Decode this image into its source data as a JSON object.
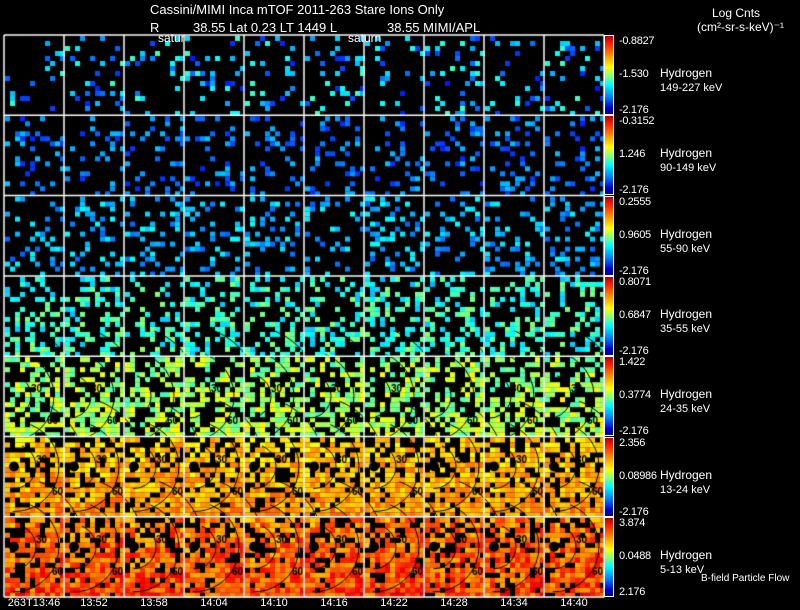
{
  "header": {
    "line1": "Cassini/MIMI Inca mTOF  2011-263    Stare    Ions Only",
    "line2_r": "R",
    "line2_rest": "38.55 Lat 0.23 LT 1449 L",
    "line2_l": "38.55  MIMI/APL",
    "overlay_left": "satur",
    "overlay_mid": "saturn"
  },
  "units": {
    "line1": "Log Cnts",
    "line2": "(cm²-sr-s-keV)⁻¹"
  },
  "footer_note": "B-field Particle Flow",
  "colormap": "jet",
  "chart_data": {
    "type": "heatmap",
    "columns": [
      "263T13:46",
      "13:52",
      "13:58",
      "14:04",
      "14:10",
      "14:16",
      "14:22",
      "14:28",
      "14:34",
      "14:40"
    ],
    "rows": [
      {
        "species": "Hydrogen",
        "energy": "149-227 keV",
        "cb_max": "-0.8827",
        "cb_mid": "-1.530",
        "cb_min": "-2.176"
      },
      {
        "species": "Hydrogen",
        "energy": "90-149 keV",
        "cb_max": "-0.3152",
        "cb_mid": "1.246",
        "cb_min": "-2.176"
      },
      {
        "species": "Hydrogen",
        "energy": "55-90 keV",
        "cb_max": "0.2555",
        "cb_mid": "0.9605",
        "cb_min": "-2.176"
      },
      {
        "species": "Hydrogen",
        "energy": "35-55 keV",
        "cb_max": "0.8071",
        "cb_mid": "0.6847",
        "cb_min": "-2.176"
      },
      {
        "species": "Hydrogen",
        "energy": "24-35 keV",
        "cb_max": "1.422",
        "cb_mid": "0.3774",
        "cb_min": "-2.176"
      },
      {
        "species": "Hydrogen",
        "energy": "13-24 keV",
        "cb_max": "2.356",
        "cb_mid": "0.08986",
        "cb_min": "-2.176"
      },
      {
        "species": "Hydrogen",
        "energy": "5-13 keV",
        "cb_max": "3.874",
        "cb_mid": "0.0488",
        "cb_min": "2.176"
      }
    ],
    "contour_labels": [
      "30",
      "60",
      "90"
    ]
  }
}
